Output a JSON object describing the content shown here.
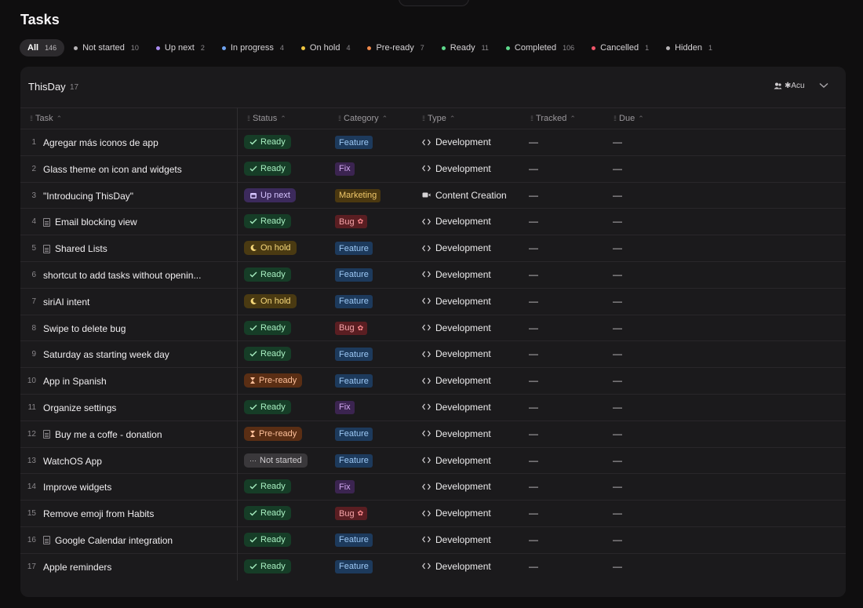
{
  "page": {
    "title": "Tasks"
  },
  "filters": [
    {
      "label": "All",
      "count": "146",
      "color": "",
      "active": true
    },
    {
      "label": "Not started",
      "count": "10",
      "color": "#b6b3b6"
    },
    {
      "label": "Up next",
      "count": "2",
      "color": "#a98bf0"
    },
    {
      "label": "In progress",
      "count": "4",
      "color": "#6fa3f0"
    },
    {
      "label": "On hold",
      "count": "4",
      "color": "#f0c640"
    },
    {
      "label": "Pre-ready",
      "count": "7",
      "color": "#f0894a"
    },
    {
      "label": "Ready",
      "count": "11",
      "color": "#5ed98c"
    },
    {
      "label": "Completed",
      "count": "106",
      "color": "#5ed98c"
    },
    {
      "label": "Cancelled",
      "count": "1",
      "color": "#f0566a"
    },
    {
      "label": "Hidden",
      "count": "1",
      "color": "#b6b3b6"
    }
  ],
  "group": {
    "title": "ThisDay",
    "count": "17",
    "assignee": "✱Acu"
  },
  "columns": {
    "task": "Task",
    "status": "Status",
    "category": "Category",
    "type": "Type",
    "tracked": "Tracked",
    "due": "Due"
  },
  "rows": [
    {
      "num": "1",
      "task": "Agregar más iconos de app",
      "doc": false,
      "status": "Ready",
      "category": "Feature",
      "type": "Development",
      "tracked": "—",
      "due": "—"
    },
    {
      "num": "2",
      "task": "Glass theme on icon and widgets",
      "doc": false,
      "status": "Ready",
      "category": "Fix",
      "type": "Development",
      "tracked": "—",
      "due": "—"
    },
    {
      "num": "3",
      "task": "\"Introducing ThisDay\"",
      "doc": false,
      "status": "Up next",
      "category": "Marketing",
      "type": "Content Creation",
      "tracked": "—",
      "due": "—"
    },
    {
      "num": "4",
      "task": "Email blocking view",
      "doc": true,
      "status": "Ready",
      "category": "Bug",
      "type": "Development",
      "tracked": "—",
      "due": "—"
    },
    {
      "num": "5",
      "task": "Shared Lists",
      "doc": true,
      "status": "On hold",
      "category": "Feature",
      "type": "Development",
      "tracked": "—",
      "due": "—"
    },
    {
      "num": "6",
      "task": "shortcut to add tasks without openin...",
      "doc": false,
      "status": "Ready",
      "category": "Feature",
      "type": "Development",
      "tracked": "—",
      "due": "—"
    },
    {
      "num": "7",
      "task": "siriAI intent",
      "doc": false,
      "status": "On hold",
      "category": "Feature",
      "type": "Development",
      "tracked": "—",
      "due": "—"
    },
    {
      "num": "8",
      "task": "Swipe to delete bug",
      "doc": false,
      "status": "Ready",
      "category": "Bug",
      "type": "Development",
      "tracked": "—",
      "due": "—"
    },
    {
      "num": "9",
      "task": "Saturday as starting week day",
      "doc": false,
      "status": "Ready",
      "category": "Feature",
      "type": "Development",
      "tracked": "—",
      "due": "—"
    },
    {
      "num": "10",
      "task": "App in Spanish",
      "doc": false,
      "status": "Pre-ready",
      "category": "Feature",
      "type": "Development",
      "tracked": "—",
      "due": "—"
    },
    {
      "num": "11",
      "task": "Organize settings",
      "doc": false,
      "status": "Ready",
      "category": "Fix",
      "type": "Development",
      "tracked": "—",
      "due": "—"
    },
    {
      "num": "12",
      "task": "Buy me a coffe - donation",
      "doc": true,
      "status": "Pre-ready",
      "category": "Feature",
      "type": "Development",
      "tracked": "—",
      "due": "—"
    },
    {
      "num": "13",
      "task": "WatchOS App",
      "doc": false,
      "status": "Not started",
      "category": "Feature",
      "type": "Development",
      "tracked": "—",
      "due": "—"
    },
    {
      "num": "14",
      "task": "Improve widgets",
      "doc": false,
      "status": "Ready",
      "category": "Fix",
      "type": "Development",
      "tracked": "—",
      "due": "—"
    },
    {
      "num": "15",
      "task": "Remove emoji from Habits",
      "doc": false,
      "status": "Ready",
      "category": "Bug",
      "type": "Development",
      "tracked": "—",
      "due": "—"
    },
    {
      "num": "16",
      "task": "Google Calendar integration",
      "doc": true,
      "status": "Ready",
      "category": "Feature",
      "type": "Development",
      "tracked": "—",
      "due": "—"
    },
    {
      "num": "17",
      "task": "Apple reminders",
      "doc": false,
      "status": "Ready",
      "category": "Feature",
      "type": "Development",
      "tracked": "—",
      "due": "—"
    }
  ],
  "icons": {
    "Ready": "check-icon",
    "Up next": "calendar-icon",
    "On hold": "moon-icon",
    "Pre-ready": "hourglass-icon",
    "Not started": "dots-icon",
    "Development": "code-icon",
    "Content Creation": "video-icon",
    "Bug": "bug-icon"
  }
}
